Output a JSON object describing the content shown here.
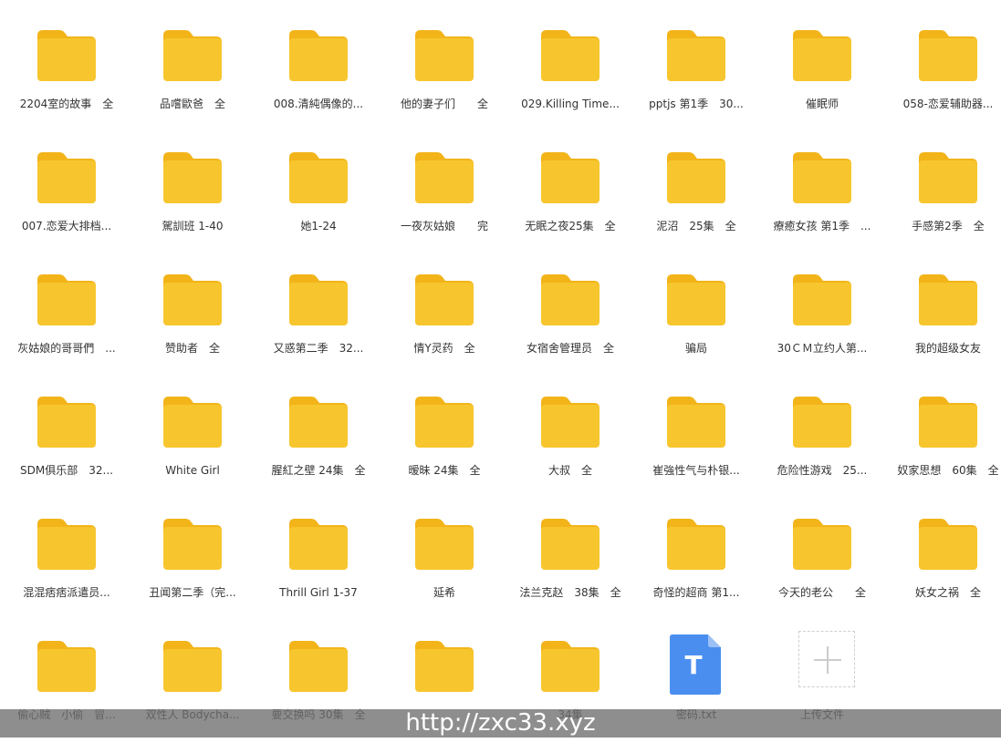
{
  "colors": {
    "folder": "#F7C62E",
    "folder_tab": "#F2B419",
    "file_blue": "#4A8FF0",
    "label_text": "#333333",
    "upload_border": "#cfcfcf"
  },
  "items": [
    {
      "type": "folder",
      "label": "2204室的故事　全"
    },
    {
      "type": "folder",
      "label": "品嚐歐爸　全"
    },
    {
      "type": "folder",
      "label": "008.清純偶像的..."
    },
    {
      "type": "folder",
      "label": "他的妻子们　　全"
    },
    {
      "type": "folder",
      "label": "029.Killing Time..."
    },
    {
      "type": "folder",
      "label": "pptjs 第1季　30..."
    },
    {
      "type": "folder",
      "label": "催眠师"
    },
    {
      "type": "folder",
      "label": "058-恋爱辅助器..."
    },
    {
      "type": "folder",
      "label": "007.恋爱大排档..."
    },
    {
      "type": "folder",
      "label": "駕訓班 1-40"
    },
    {
      "type": "folder",
      "label": "她1-24"
    },
    {
      "type": "folder",
      "label": "一夜灰姑娘　　完"
    },
    {
      "type": "folder",
      "label": "无眠之夜25集　全"
    },
    {
      "type": "folder",
      "label": "泥沼　25集　全"
    },
    {
      "type": "folder",
      "label": "療癒女孩 第1季　..."
    },
    {
      "type": "folder",
      "label": "手感第2季　全"
    },
    {
      "type": "folder",
      "label": "灰姑娘的哥哥們　..."
    },
    {
      "type": "folder",
      "label": "赞助者　全"
    },
    {
      "type": "folder",
      "label": "又惑第二季　32..."
    },
    {
      "type": "folder",
      "label": "情Y灵药　全"
    },
    {
      "type": "folder",
      "label": "女宿舍管理员　全"
    },
    {
      "type": "folder",
      "label": "骗局"
    },
    {
      "type": "folder",
      "label": "30ＣＭ立约人第..."
    },
    {
      "type": "folder",
      "label": "我的超级女友"
    },
    {
      "type": "folder",
      "label": "SDM俱乐部　32..."
    },
    {
      "type": "folder",
      "label": "White Girl"
    },
    {
      "type": "folder",
      "label": "腥紅之壁 24集　全"
    },
    {
      "type": "folder",
      "label": "暧昧 24集　全"
    },
    {
      "type": "folder",
      "label": "大叔　全"
    },
    {
      "type": "folder",
      "label": "崔強性气与朴银..."
    },
    {
      "type": "folder",
      "label": "危险性游戏　25..."
    },
    {
      "type": "folder",
      "label": "奴家思想　60集　全"
    },
    {
      "type": "folder",
      "label": "混混痞痞派遣员..."
    },
    {
      "type": "folder",
      "label": "丑闻第二季（完..."
    },
    {
      "type": "folder",
      "label": "Thrill Girl 1-37"
    },
    {
      "type": "folder",
      "label": "延希"
    },
    {
      "type": "folder",
      "label": "法兰克赵　38集　全"
    },
    {
      "type": "folder",
      "label": "奇怪的超商 第1..."
    },
    {
      "type": "folder",
      "label": "今天的老公　　全"
    },
    {
      "type": "folder",
      "label": "妖女之祸　全"
    },
    {
      "type": "folder",
      "label": "偷心贼　小偷　冒..."
    },
    {
      "type": "folder",
      "label": "双性人 Bodycha..."
    },
    {
      "type": "folder",
      "label": "要交换吗 30集　全"
    },
    {
      "type": "folder",
      "label": ""
    },
    {
      "type": "folder",
      "label": "34集"
    },
    {
      "type": "file",
      "label": "密码.txt",
      "icon_letter": "T"
    },
    {
      "type": "upload",
      "label": "上传文件"
    }
  ],
  "watermark": {
    "text": "http://zxc33.xyz"
  }
}
